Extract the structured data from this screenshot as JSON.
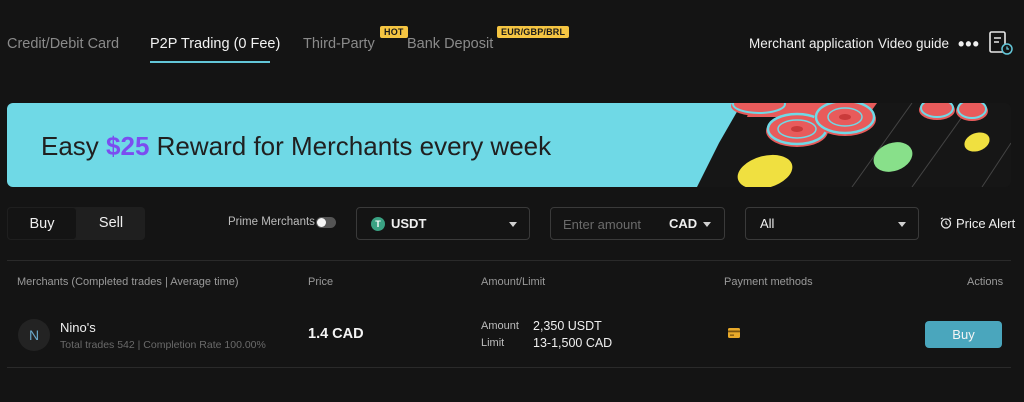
{
  "nav": {
    "tabs": [
      {
        "label": "Credit/Debit Card",
        "active": false
      },
      {
        "label": "P2P Trading (0 Fee)",
        "active": true
      },
      {
        "label": "Third-Party",
        "active": false,
        "badge": "HOT"
      },
      {
        "label": "Bank Deposit",
        "active": false,
        "badge": "EUR/GBP/BRL"
      }
    ],
    "links": {
      "merchant_application": "Merchant application",
      "video_guide": "Video guide",
      "more": "•••"
    }
  },
  "banner": {
    "text_before": "Easy ",
    "highlight": "$25",
    "text_after": " Reward for Merchants every week",
    "colors": {
      "background": "#6fd9e6",
      "highlight": "#7b4df0"
    }
  },
  "filters": {
    "side_buy": "Buy",
    "side_sell": "Sell",
    "prime_merchants_label": "Prime Merchants",
    "prime_merchants_enabled": false,
    "crypto": {
      "icon": "tether-icon",
      "icon_glyph": "T",
      "value": "USDT"
    },
    "amount": {
      "placeholder": "Enter amount",
      "value": "",
      "currency": "CAD"
    },
    "payment_method": "All",
    "price_alert": "Price Alert"
  },
  "table": {
    "headers": {
      "merchants": "Merchants (Completed trades | Average time)",
      "price": "Price",
      "amount_limit": "Amount/Limit",
      "payment_methods": "Payment methods",
      "actions": "Actions"
    },
    "rows": [
      {
        "avatar_initial": "N",
        "name": "Nino's",
        "stats": "Total trades 542 | Completion Rate 100.00%",
        "price": "1.4 CAD",
        "amount_label": "Amount",
        "amount": "2,350 USDT",
        "limit_label": "Limit",
        "limit": "13-1,500 CAD",
        "payment_icon": "card-icon",
        "action": "Buy"
      }
    ]
  },
  "colors": {
    "accent": "#63c6d8",
    "buy_button": "#4aa6bd",
    "badge": "#f5c542"
  }
}
